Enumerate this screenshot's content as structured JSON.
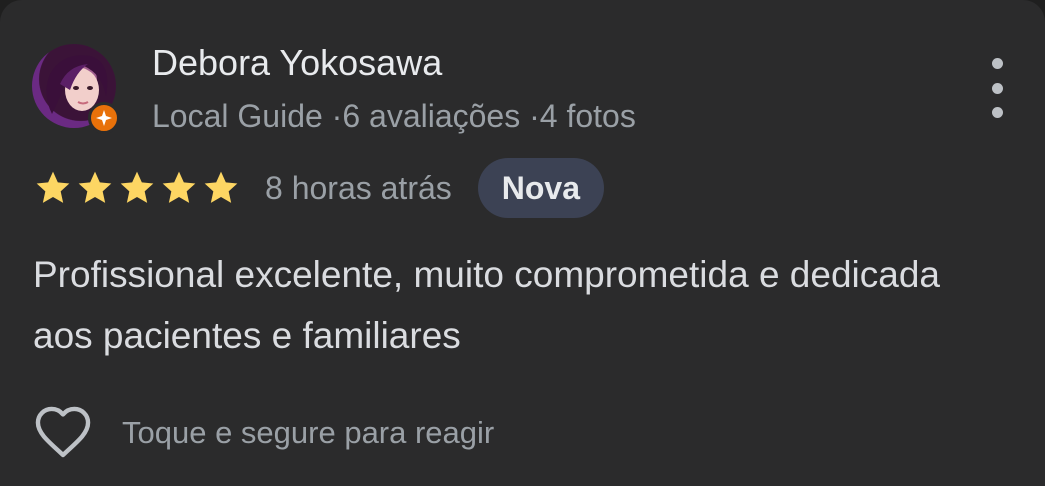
{
  "review": {
    "author": "Debora Yokosawa",
    "author_meta": {
      "role": "Local Guide",
      "separator": "·",
      "reviews": "6 avaliações",
      "photos": "4 fotos"
    },
    "rating": 5,
    "rating_max": 5,
    "time_ago": "8 horas atrás",
    "badge": "Nova",
    "text": "Profissional excelente, muito comprometida e dedicada aos pacientes e familiares",
    "react_label": "Toque e segure para reagir"
  },
  "icons": {
    "avatar": "profile-photo",
    "badge": "local-guide-star-icon",
    "more": "more-vert-icon",
    "star": "star-icon",
    "heart": "heart-outline-icon"
  },
  "colors": {
    "background": "#2b2b2c",
    "star": "#fdd663",
    "badge_bg": "#3c4254",
    "guide_badge": "#e8710a",
    "primary_text": "#e8eaed",
    "secondary_text": "#9aa0a6"
  }
}
